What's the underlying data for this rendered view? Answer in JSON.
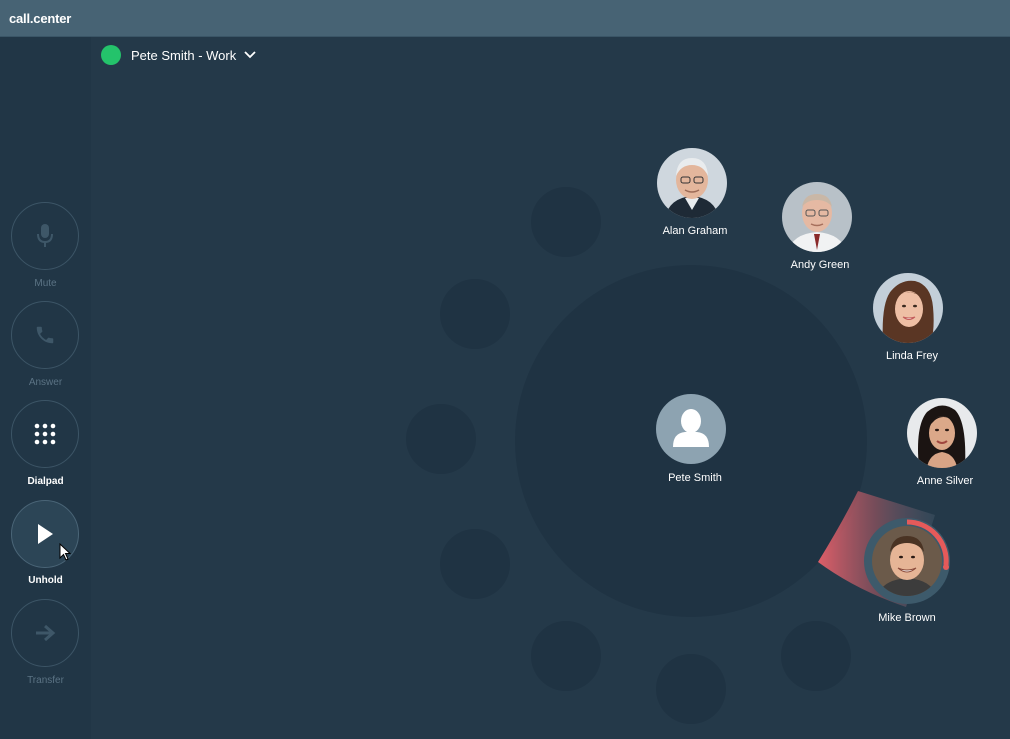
{
  "app": {
    "title": "call.center"
  },
  "status": {
    "name": "Pete Smith - Work",
    "color": "#24c36b",
    "icon": "chevron-down-icon"
  },
  "controls": [
    {
      "id": "mute",
      "label": "Mute",
      "icon": "microphone-icon",
      "enabled": false
    },
    {
      "id": "answer",
      "label": "Answer",
      "icon": "phone-icon",
      "enabled": false
    },
    {
      "id": "dialpad",
      "label": "Dialpad",
      "icon": "dialpad-icon",
      "enabled": true
    },
    {
      "id": "unhold",
      "label": "Unhold",
      "icon": "play-icon",
      "enabled": true
    },
    {
      "id": "transfer",
      "label": "Transfer",
      "icon": "arrow-right-icon",
      "enabled": false
    }
  ],
  "center_contact": {
    "name": "Pete Smith",
    "icon": "user-silhouette-icon"
  },
  "contacts": [
    {
      "name": "Alan Graham"
    },
    {
      "name": "Andy Green"
    },
    {
      "name": "Linda Frey"
    },
    {
      "name": "Anne Silver"
    },
    {
      "name": "Mike Brown",
      "active": true,
      "progress_ring_color": "#e55a5a"
    }
  ],
  "colors": {
    "background": "#243949",
    "titlebar": "#476374",
    "sidebar": "#213646",
    "slot": "#1f3343",
    "accent_red": "#e55a5a"
  }
}
